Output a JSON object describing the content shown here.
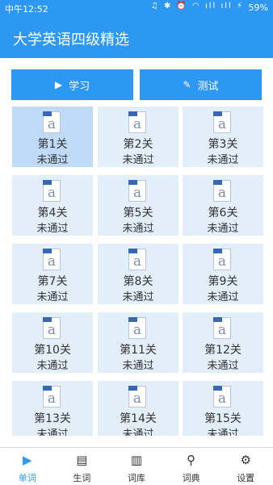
{
  "status": {
    "time": "中午12:52",
    "battery": "59%",
    "icons": "♫ ✱ ⏰ ◠ ıll ıll ⚡"
  },
  "app": {
    "title": "大学英语四级精选"
  },
  "actions": {
    "study_label": "学习",
    "test_label": "测试"
  },
  "levels": [
    {
      "label": "第1关",
      "status": "未通过"
    },
    {
      "label": "第2关",
      "status": "未通过"
    },
    {
      "label": "第3关",
      "status": "未通过"
    },
    {
      "label": "第4关",
      "status": "未通过"
    },
    {
      "label": "第5关",
      "status": "未通过"
    },
    {
      "label": "第6关",
      "status": "未通过"
    },
    {
      "label": "第7关",
      "status": "未通过"
    },
    {
      "label": "第8关",
      "status": "未通过"
    },
    {
      "label": "第9关",
      "status": "未通过"
    },
    {
      "label": "第10关",
      "status": "未通过"
    },
    {
      "label": "第11关",
      "status": "未通过"
    },
    {
      "label": "第12关",
      "status": "未通过"
    },
    {
      "label": "第13关",
      "status": "未通过"
    },
    {
      "label": "第14关",
      "status": "未通过"
    },
    {
      "label": "第15关",
      "status": "未通过"
    }
  ],
  "tabs": [
    {
      "label": "单词",
      "icon": "play-icon"
    },
    {
      "label": "生词",
      "icon": "notebook-icon"
    },
    {
      "label": "词库",
      "icon": "book-icon"
    },
    {
      "label": "词典",
      "icon": "search-icon"
    },
    {
      "label": "设置",
      "icon": "gear-icon"
    }
  ],
  "colors": {
    "primary": "#2d97f4",
    "tile": "#e3eefb",
    "tile_active": "#c0dbf7"
  }
}
